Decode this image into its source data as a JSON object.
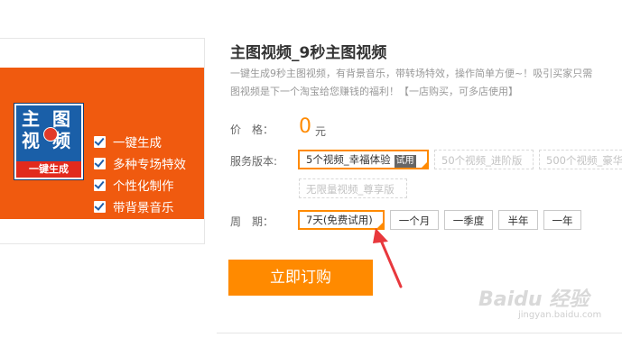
{
  "product": {
    "title": "主图视频_9秒主图视频",
    "desc_line1": "一键生成9秒主图视频，有背景音乐，带转场特效，操作简单方便~！吸引买家只需",
    "desc_line2": "图视频是下一个淘宝给您赚钱的福利！【一店购买，可多店使用】"
  },
  "banner": {
    "logo_chars": [
      "主",
      "图",
      "视",
      "频"
    ],
    "logo_bar": "一键生成",
    "features": [
      "一键生成",
      "多种专场特效",
      "个性化制作",
      "带背景音乐"
    ]
  },
  "price": {
    "label": "价　格：",
    "value": "0",
    "unit": "元"
  },
  "service": {
    "label": "服务版本:",
    "options": [
      {
        "text": "5个视频_幸福体验",
        "badge": "试用",
        "state": "selected"
      },
      {
        "text": "50个视频_进阶版",
        "state": "disabled"
      },
      {
        "text": "500个视频_豪华",
        "state": "disabled"
      },
      {
        "text": "无限量视频_尊享版",
        "state": "disabled"
      }
    ]
  },
  "period": {
    "label": "周　期：",
    "options": [
      {
        "text": "7天(免费试用)",
        "state": "selected"
      },
      {
        "text": "一个月",
        "state": "normal"
      },
      {
        "text": "一季度",
        "state": "normal"
      },
      {
        "text": "半年",
        "state": "normal"
      },
      {
        "text": "一年",
        "state": "normal"
      }
    ]
  },
  "buy_button": "立即订购",
  "watermark": {
    "brand": "Baidu 经验",
    "url": "jingyan.baidu.com"
  },
  "colors": {
    "accent": "#ff8a00",
    "banner": "#f05a0f",
    "logo_blue": "#1a5fa8",
    "arrow": "#e8383d"
  }
}
